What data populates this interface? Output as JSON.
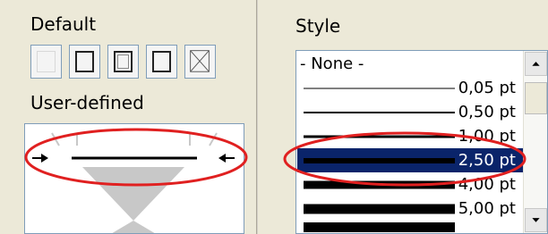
{
  "left_panel": {
    "default_title": "Default",
    "user_defined_title": "User-defined",
    "presets": [
      {
        "icon": "no-border-icon"
      },
      {
        "icon": "outer-border-icon"
      },
      {
        "icon": "outer-and-inner-border-icon"
      },
      {
        "icon": "outer-border-only-icon"
      },
      {
        "icon": "diagonal-borders-icon"
      }
    ]
  },
  "right_panel": {
    "style_title": "Style",
    "items": [
      {
        "label": "- None -"
      },
      {
        "label": "0,05 pt"
      },
      {
        "label": "0,50 pt"
      },
      {
        "label": "1,00 pt"
      },
      {
        "label": "2,50 pt"
      },
      {
        "label": "4,00 pt"
      },
      {
        "label": "5,00 pt"
      }
    ]
  },
  "colors": {
    "selected_background": "#0a246a",
    "selected_text": "#ffffff",
    "highlight_ellipse": "#e02020",
    "panel_background": "#ece9d8"
  }
}
